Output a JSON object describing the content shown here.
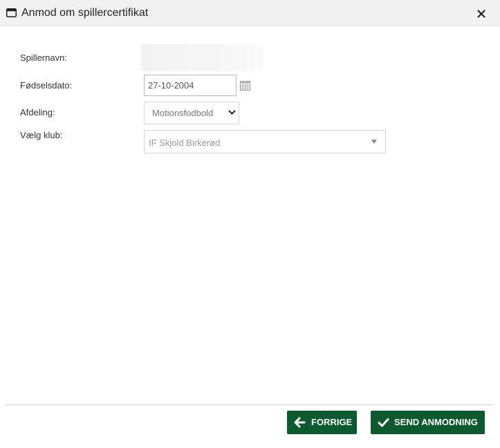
{
  "dialog": {
    "title": "Anmod om spillercertifikat",
    "title_icon": "window-icon",
    "close_icon": "close-icon"
  },
  "form": {
    "player_name_label": "Spillernavn:",
    "player_name_value": "",
    "birthdate_label": "Fødselsdato:",
    "birthdate_value": "27-10-2004",
    "calendar_icon": "calendar-icon",
    "department_label": "Afdeling:",
    "department_selected": "Motionsfodbold",
    "club_label": "Vælg klub:",
    "club_selected": "IF Skjold Birkerød"
  },
  "footer": {
    "back_label": "FORRIGE",
    "back_icon": "arrow-left-icon",
    "send_label": "SEND ANMODNING",
    "send_icon": "checkmark-icon"
  },
  "colors": {
    "button_bg": "#0c5a2e",
    "titlebar_bg": "#f1f1f1"
  }
}
